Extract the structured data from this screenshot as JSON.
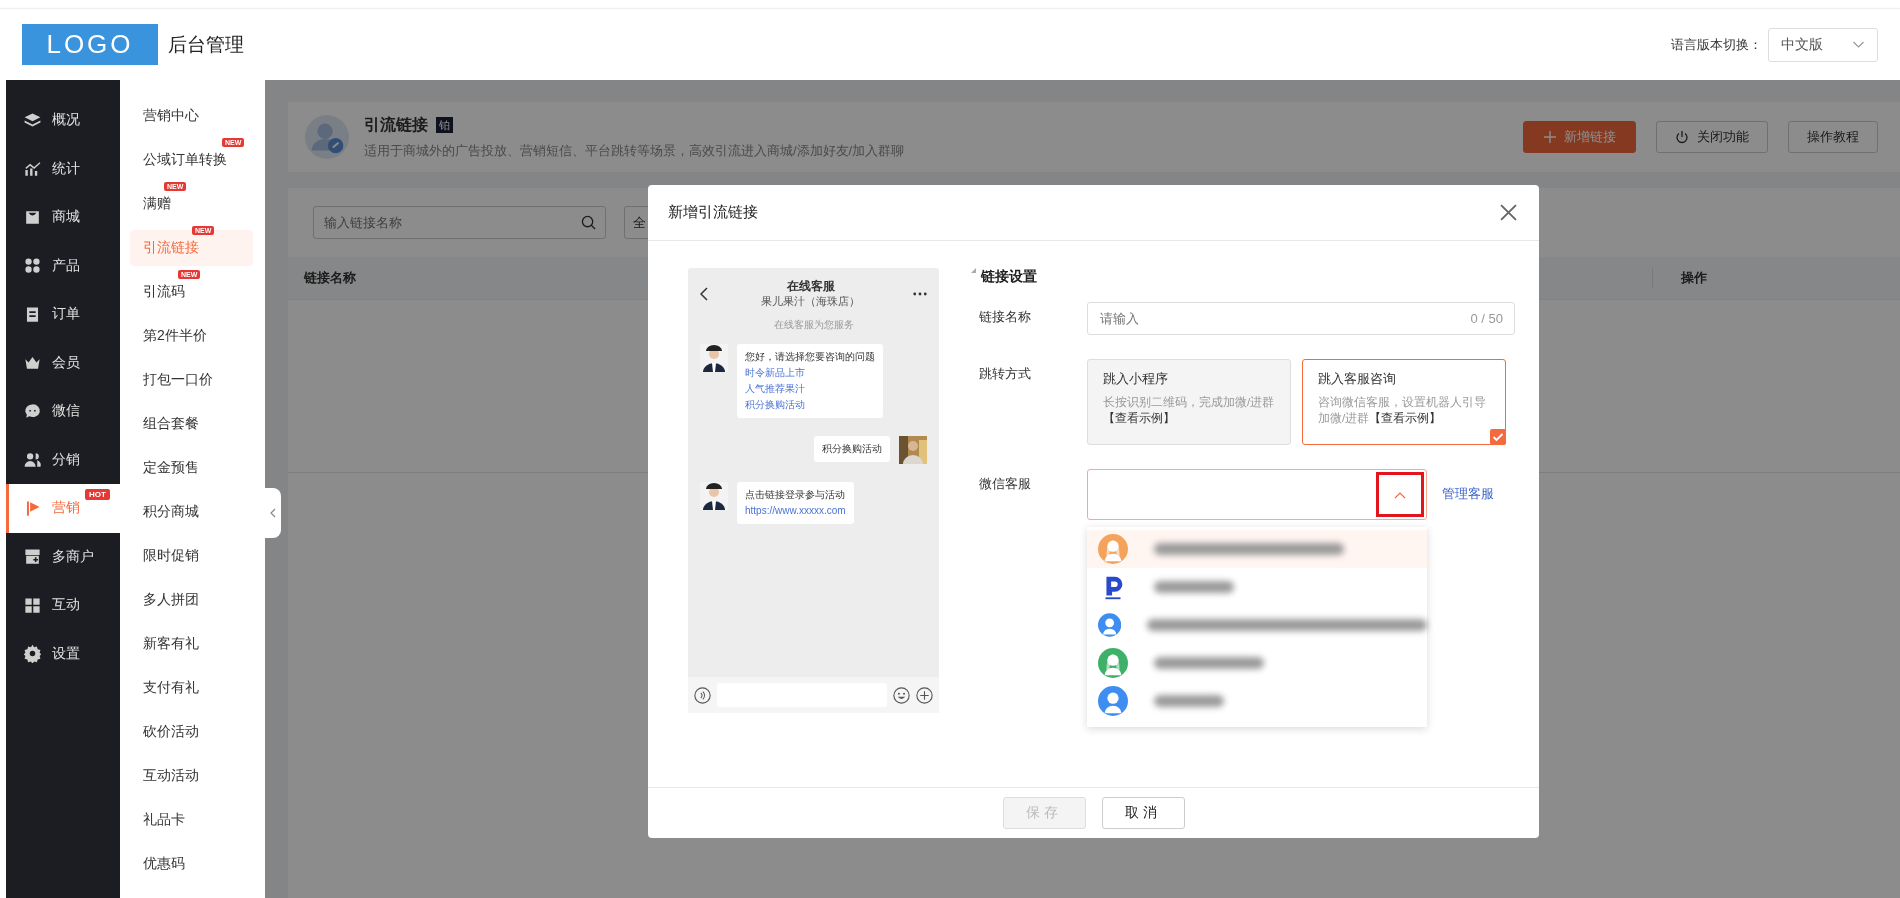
{
  "header": {
    "logo": "LOGO",
    "title": "后台管理",
    "language_label": "语言版本切换：",
    "language": "中文版"
  },
  "nav": [
    {
      "label": "概况",
      "selected": false
    },
    {
      "label": "统计",
      "selected": false
    },
    {
      "label": "商城",
      "selected": false
    },
    {
      "label": "产品",
      "selected": false
    },
    {
      "label": "订单",
      "selected": false
    },
    {
      "label": "会员",
      "selected": false
    },
    {
      "label": "微信",
      "selected": false
    },
    {
      "label": "分销",
      "selected": false
    },
    {
      "label": "营销",
      "selected": true,
      "badge": "HOT"
    },
    {
      "label": "多商户",
      "selected": false
    },
    {
      "label": "互动",
      "selected": false
    },
    {
      "label": "设置",
      "selected": false
    }
  ],
  "subnav": [
    {
      "label": "营销中心",
      "selected": false
    },
    {
      "label": "公域订单转换",
      "selected": false,
      "badge": "NEW"
    },
    {
      "label": "满赠",
      "selected": false,
      "badge": "NEW"
    },
    {
      "label": "引流链接",
      "selected": true,
      "badge": "NEW"
    },
    {
      "label": "引流码",
      "selected": false,
      "badge": "NEW"
    },
    {
      "label": "第2件半价",
      "selected": false
    },
    {
      "label": "打包一口价",
      "selected": false
    },
    {
      "label": "组合套餐",
      "selected": false
    },
    {
      "label": "定金预售",
      "selected": false
    },
    {
      "label": "积分商城",
      "selected": false
    },
    {
      "label": "限时促销",
      "selected": false
    },
    {
      "label": "多人拼团",
      "selected": false
    },
    {
      "label": "新客有礼",
      "selected": false
    },
    {
      "label": "支付有礼",
      "selected": false
    },
    {
      "label": "砍价活动",
      "selected": false
    },
    {
      "label": "互动活动",
      "selected": false
    },
    {
      "label": "礼品卡",
      "selected": false
    },
    {
      "label": "优惠码",
      "selected": false
    }
  ],
  "page": {
    "title": "引流链接",
    "tier_badge": "铂",
    "description": "适用于商城外的广告投放、营销短信、平台跳转等场景，高效引流进入商城/添加好友/加入群聊",
    "buttons": [
      {
        "label": "新增链接",
        "kind": "primary"
      },
      {
        "label": "关闭功能",
        "kind": "power"
      },
      {
        "label": "操作教程",
        "kind": "plain"
      }
    ]
  },
  "filter": {
    "search_placeholder": "输入链接名称",
    "select_value": "全"
  },
  "table": {
    "columns": [
      {
        "label": "链接名称"
      },
      {
        "label": "操作"
      }
    ]
  },
  "modal": {
    "title": "新增引流链接",
    "preview": {
      "title": "在线客服",
      "subtitle": "果儿果汁（海珠店）",
      "notice": "在线客服为您服务",
      "messages": [
        {
          "kind": "agent",
          "text": "您好，请选择您要咨询的问题",
          "links": [
            "时令新品上市",
            "人气推荐果汁",
            "积分换购活动"
          ]
        },
        {
          "kind": "user",
          "text": "积分换购活动"
        },
        {
          "kind": "agent",
          "text": "点击链接登录参与活动",
          "links": [
            "https://www.xxxxx.com"
          ]
        }
      ]
    },
    "section_title": "链接设置",
    "name_field": {
      "label": "链接名称",
      "placeholder": "请输入",
      "counter": "0 / 50"
    },
    "jump": {
      "label": "跳转方式",
      "options": [
        {
          "title": "跳入小程序",
          "description": "长按识别二维码，完成加微/进群**【查看示例】**",
          "selected": false
        },
        {
          "title": "跳入客服咨询",
          "description": "咨询微信客服，设置机器人引导加微/进群**【查看示例】**",
          "selected": true
        }
      ]
    },
    "service": {
      "label": "微信客服",
      "expanded": true,
      "highlighted": true,
      "manage_link": "管理客服",
      "options": [
        {
          "kind": "female",
          "color": "#f5a35c",
          "selected": true
        },
        {
          "kind": "logo",
          "color": "#2b4acb",
          "selected": false
        },
        {
          "kind": "male",
          "color": "#3d8ef0",
          "selected": false
        },
        {
          "kind": "female",
          "color": "#3fb06a",
          "selected": false
        },
        {
          "kind": "male",
          "color": "#3d8ef0",
          "selected": false
        }
      ]
    },
    "buttons": [
      {
        "label": "保存",
        "disabled": true
      },
      {
        "label": "取消",
        "disabled": false
      }
    ]
  }
}
